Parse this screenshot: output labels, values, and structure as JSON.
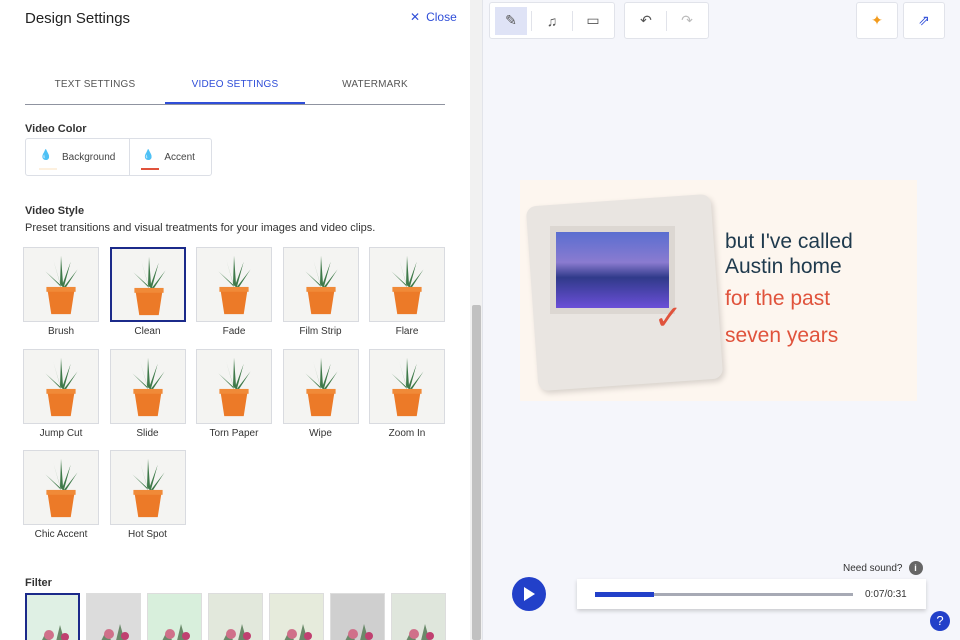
{
  "panel": {
    "title": "Design Settings",
    "close_label": "Close",
    "tabs": [
      {
        "label": "TEXT SETTINGS"
      },
      {
        "label": "VIDEO SETTINGS"
      },
      {
        "label": "WATERMARK"
      }
    ],
    "video_color": {
      "heading": "Video Color",
      "background_label": "Background",
      "accent_label": "Accent",
      "accent_color": "#e0533c",
      "background_color": "#fdf6ef"
    },
    "video_style": {
      "heading": "Video Style",
      "description": "Preset transitions and visual treatments for your images and video clips.",
      "styles": [
        {
          "label": "Brush"
        },
        {
          "label": "Clean"
        },
        {
          "label": "Fade"
        },
        {
          "label": "Film Strip"
        },
        {
          "label": "Flare"
        },
        {
          "label": "Jump Cut"
        },
        {
          "label": "Slide"
        },
        {
          "label": "Torn Paper"
        },
        {
          "label": "Wipe"
        },
        {
          "label": "Zoom In"
        },
        {
          "label": "Chic Accent"
        },
        {
          "label": "Hot Spot"
        }
      ],
      "selected": "Clean"
    },
    "filter": {
      "heading": "Filter"
    }
  },
  "preview": {
    "lines": [
      "but I've called",
      "Austin home",
      "for the past",
      "seven years"
    ]
  },
  "player": {
    "need_sound": "Need sound?",
    "time": "0:07/0:31",
    "progress": 0.23
  },
  "colors": {
    "accent": "#2240c9",
    "brand_text": "#2f4ed8"
  }
}
